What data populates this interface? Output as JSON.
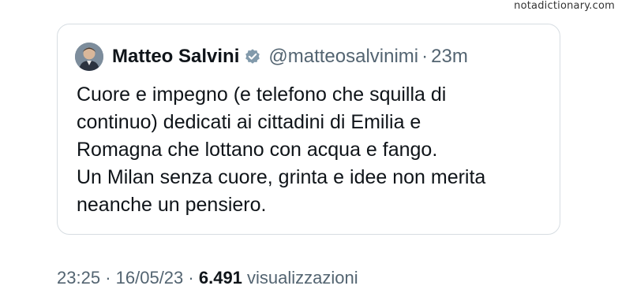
{
  "watermark": "notadictionary.com",
  "quoted_tweet": {
    "author_name": "Matteo Salvini",
    "handle": "@matteosalvinimi",
    "separator": "·",
    "time": "23m",
    "verified_icon": "verified-badge-icon",
    "text": "Cuore e impegno (e telefono che squilla di\ncontinuo) dedicati ai cittadini di Emilia e\nRomagna che lottano con acqua e fango.\nUn Milan senza cuore, grinta e idee non merita\nneanche un pensiero."
  },
  "meta": {
    "time": "23:25",
    "separator1": "·",
    "date": "16/05/23",
    "separator2": "·",
    "views_count": "6.491",
    "views_label": "visualizzazioni"
  },
  "colors": {
    "text": "#0f1419",
    "secondary": "#536471",
    "border": "#d7dde2",
    "badge": "#829aab"
  }
}
